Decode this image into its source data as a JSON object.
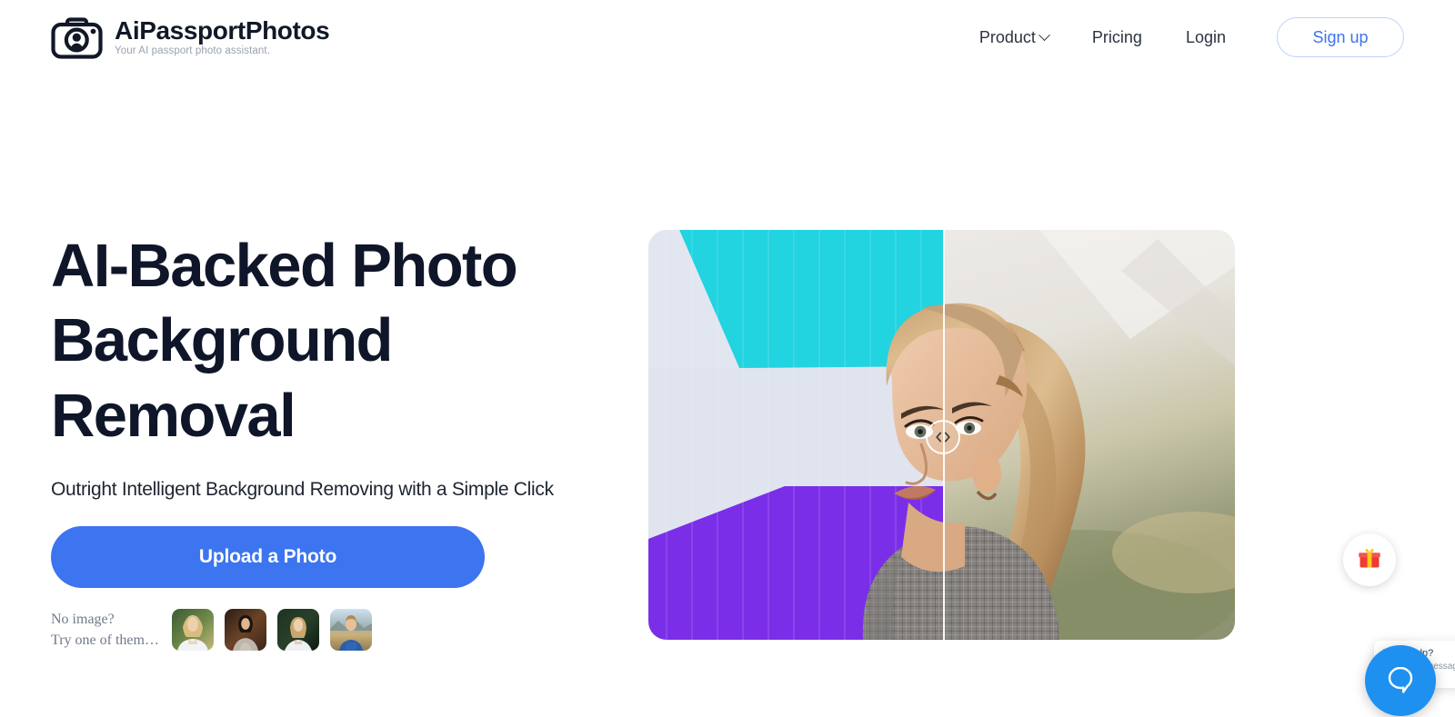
{
  "brand": {
    "name": "AiPassportPhotos",
    "tagline": "Your AI passport photo assistant.",
    "logo_icon": "camera-portrait-icon"
  },
  "nav": {
    "items": [
      {
        "label": "Product",
        "has_dropdown": true,
        "icon": "chevron-down-icon"
      },
      {
        "label": "Pricing",
        "has_dropdown": false
      },
      {
        "label": "Login",
        "has_dropdown": false
      }
    ],
    "signup_label": "Sign up"
  },
  "hero": {
    "headline": "AI-Backed Photo Background Removal",
    "subheadline": "Outright Intelligent Background Removing with a Simple Click",
    "upload_label": "Upload a Photo",
    "samples_label_line1": "No image?",
    "samples_label_line2": "Try one of them…",
    "thumbnails": [
      {
        "name": "sample-thumb-1",
        "alt": "Blonde woman in white top, green outdoor background"
      },
      {
        "name": "sample-thumb-2",
        "alt": "Dark haired woman in grey top, brown background"
      },
      {
        "name": "sample-thumb-3",
        "alt": "Blonde woman in white shirt, dark green foliage background"
      },
      {
        "name": "sample-thumb-4",
        "alt": "Man in blue t-shirt, mountain landscape background"
      }
    ],
    "comparison": {
      "handle_icon": "left-right-chevrons-icon",
      "divider_position_pct": 50,
      "before_alt": "Portrait with original colorful painted wall background",
      "after_alt": "Portrait with background removed and replaced by soft neutral blur"
    }
  },
  "widgets": {
    "gift_icon": "gift-icon",
    "beacon_icon": "chat-bubble-icon",
    "beacon_popup_title": "Need help?",
    "beacon_popup_sub": "Send us a message"
  },
  "colors": {
    "accent_blue": "#3d74f0",
    "signup_border": "#bcd2fb",
    "headline": "#101629",
    "cyan": "#22d3e0",
    "purple": "#7b2ee8",
    "wall_white": "#dfe4ef",
    "beacon_blue": "#1e90f0",
    "page_bg": "#ffffff"
  }
}
